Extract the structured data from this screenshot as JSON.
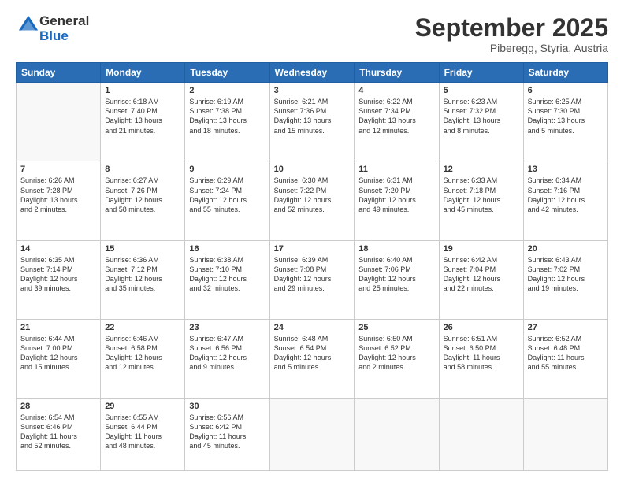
{
  "logo": {
    "general": "General",
    "blue": "Blue"
  },
  "header": {
    "month": "September 2025",
    "location": "Piberegg, Styria, Austria"
  },
  "weekdays": [
    "Sunday",
    "Monday",
    "Tuesday",
    "Wednesday",
    "Thursday",
    "Friday",
    "Saturday"
  ],
  "weeks": [
    [
      {
        "day": "",
        "info": ""
      },
      {
        "day": "1",
        "info": "Sunrise: 6:18 AM\nSunset: 7:40 PM\nDaylight: 13 hours\nand 21 minutes."
      },
      {
        "day": "2",
        "info": "Sunrise: 6:19 AM\nSunset: 7:38 PM\nDaylight: 13 hours\nand 18 minutes."
      },
      {
        "day": "3",
        "info": "Sunrise: 6:21 AM\nSunset: 7:36 PM\nDaylight: 13 hours\nand 15 minutes."
      },
      {
        "day": "4",
        "info": "Sunrise: 6:22 AM\nSunset: 7:34 PM\nDaylight: 13 hours\nand 12 minutes."
      },
      {
        "day": "5",
        "info": "Sunrise: 6:23 AM\nSunset: 7:32 PM\nDaylight: 13 hours\nand 8 minutes."
      },
      {
        "day": "6",
        "info": "Sunrise: 6:25 AM\nSunset: 7:30 PM\nDaylight: 13 hours\nand 5 minutes."
      }
    ],
    [
      {
        "day": "7",
        "info": "Sunrise: 6:26 AM\nSunset: 7:28 PM\nDaylight: 13 hours\nand 2 minutes."
      },
      {
        "day": "8",
        "info": "Sunrise: 6:27 AM\nSunset: 7:26 PM\nDaylight: 12 hours\nand 58 minutes."
      },
      {
        "day": "9",
        "info": "Sunrise: 6:29 AM\nSunset: 7:24 PM\nDaylight: 12 hours\nand 55 minutes."
      },
      {
        "day": "10",
        "info": "Sunrise: 6:30 AM\nSunset: 7:22 PM\nDaylight: 12 hours\nand 52 minutes."
      },
      {
        "day": "11",
        "info": "Sunrise: 6:31 AM\nSunset: 7:20 PM\nDaylight: 12 hours\nand 49 minutes."
      },
      {
        "day": "12",
        "info": "Sunrise: 6:33 AM\nSunset: 7:18 PM\nDaylight: 12 hours\nand 45 minutes."
      },
      {
        "day": "13",
        "info": "Sunrise: 6:34 AM\nSunset: 7:16 PM\nDaylight: 12 hours\nand 42 minutes."
      }
    ],
    [
      {
        "day": "14",
        "info": "Sunrise: 6:35 AM\nSunset: 7:14 PM\nDaylight: 12 hours\nand 39 minutes."
      },
      {
        "day": "15",
        "info": "Sunrise: 6:36 AM\nSunset: 7:12 PM\nDaylight: 12 hours\nand 35 minutes."
      },
      {
        "day": "16",
        "info": "Sunrise: 6:38 AM\nSunset: 7:10 PM\nDaylight: 12 hours\nand 32 minutes."
      },
      {
        "day": "17",
        "info": "Sunrise: 6:39 AM\nSunset: 7:08 PM\nDaylight: 12 hours\nand 29 minutes."
      },
      {
        "day": "18",
        "info": "Sunrise: 6:40 AM\nSunset: 7:06 PM\nDaylight: 12 hours\nand 25 minutes."
      },
      {
        "day": "19",
        "info": "Sunrise: 6:42 AM\nSunset: 7:04 PM\nDaylight: 12 hours\nand 22 minutes."
      },
      {
        "day": "20",
        "info": "Sunrise: 6:43 AM\nSunset: 7:02 PM\nDaylight: 12 hours\nand 19 minutes."
      }
    ],
    [
      {
        "day": "21",
        "info": "Sunrise: 6:44 AM\nSunset: 7:00 PM\nDaylight: 12 hours\nand 15 minutes."
      },
      {
        "day": "22",
        "info": "Sunrise: 6:46 AM\nSunset: 6:58 PM\nDaylight: 12 hours\nand 12 minutes."
      },
      {
        "day": "23",
        "info": "Sunrise: 6:47 AM\nSunset: 6:56 PM\nDaylight: 12 hours\nand 9 minutes."
      },
      {
        "day": "24",
        "info": "Sunrise: 6:48 AM\nSunset: 6:54 PM\nDaylight: 12 hours\nand 5 minutes."
      },
      {
        "day": "25",
        "info": "Sunrise: 6:50 AM\nSunset: 6:52 PM\nDaylight: 12 hours\nand 2 minutes."
      },
      {
        "day": "26",
        "info": "Sunrise: 6:51 AM\nSunset: 6:50 PM\nDaylight: 11 hours\nand 58 minutes."
      },
      {
        "day": "27",
        "info": "Sunrise: 6:52 AM\nSunset: 6:48 PM\nDaylight: 11 hours\nand 55 minutes."
      }
    ],
    [
      {
        "day": "28",
        "info": "Sunrise: 6:54 AM\nSunset: 6:46 PM\nDaylight: 11 hours\nand 52 minutes."
      },
      {
        "day": "29",
        "info": "Sunrise: 6:55 AM\nSunset: 6:44 PM\nDaylight: 11 hours\nand 48 minutes."
      },
      {
        "day": "30",
        "info": "Sunrise: 6:56 AM\nSunset: 6:42 PM\nDaylight: 11 hours\nand 45 minutes."
      },
      {
        "day": "",
        "info": ""
      },
      {
        "day": "",
        "info": ""
      },
      {
        "day": "",
        "info": ""
      },
      {
        "day": "",
        "info": ""
      }
    ]
  ]
}
